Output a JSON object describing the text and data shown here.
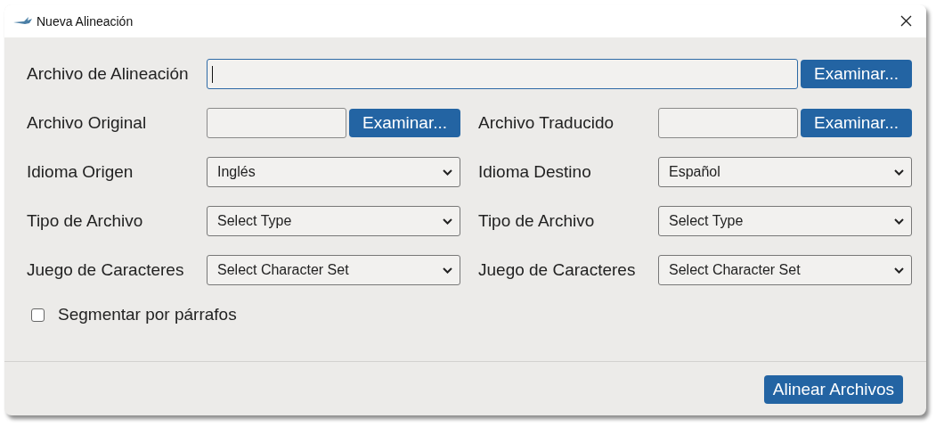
{
  "window": {
    "title": "Nueva Alineación"
  },
  "alignment_file": {
    "label": "Archivo de Alineación",
    "focused": true,
    "button": "Examinar..."
  },
  "files": [
    {
      "label": "Archivo Original",
      "button": "Examinar..."
    },
    {
      "label": "Archivo Traducido",
      "button": "Examinar..."
    }
  ],
  "select_rows": [
    [
      {
        "label": "Idioma Origen",
        "value": "Inglés"
      },
      {
        "label": "Idioma Destino",
        "value": "Español"
      }
    ],
    [
      {
        "label": "Tipo de Archivo",
        "value": "Select Type"
      },
      {
        "label": "Tipo de Archivo",
        "value": "Select Type"
      }
    ],
    [
      {
        "label": "Juego de Caracteres",
        "value": "Select Character Set"
      },
      {
        "label": "Juego de Caracteres",
        "value": "Select Character Set"
      }
    ]
  ],
  "segment_option": {
    "label": "Segmentar por párrafos",
    "checked": false
  },
  "footer": {
    "button": "Alinear Archivos"
  }
}
